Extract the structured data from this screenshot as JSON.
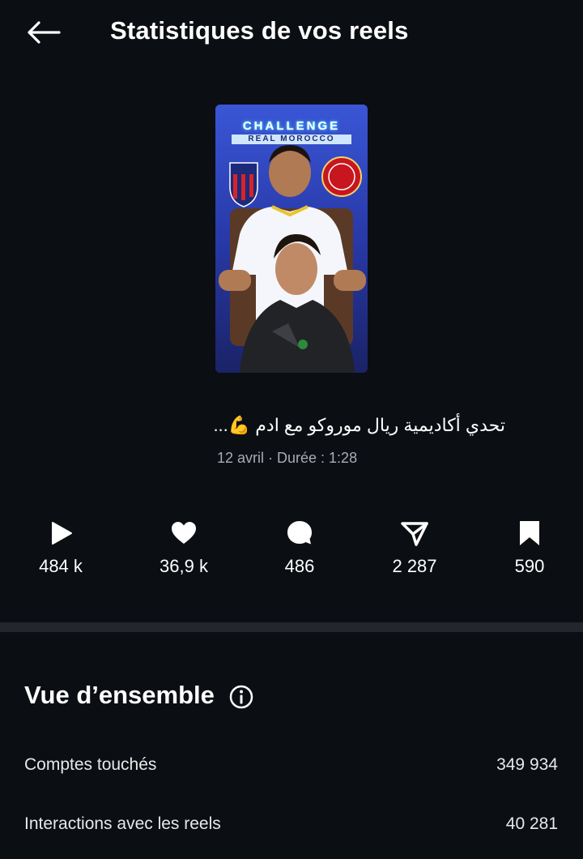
{
  "header": {
    "title": "Statistiques de vos reels",
    "back_icon": "arrow-left-icon"
  },
  "reel": {
    "thumbnail_text_line1": "CHALLENGE",
    "thumbnail_text_line2": "REAL MOROCCO",
    "caption": "تحدي أكاديمية ريال موروكو مع ادم 💪...",
    "meta": "12 avril · Durée : 1:28"
  },
  "stats": [
    {
      "icon": "play-icon",
      "value": "484 k"
    },
    {
      "icon": "heart-icon",
      "value": "36,9 k"
    },
    {
      "icon": "comment-icon",
      "value": "486"
    },
    {
      "icon": "share-icon",
      "value": "2 287"
    },
    {
      "icon": "bookmark-icon",
      "value": "590"
    }
  ],
  "overview": {
    "title": "Vue d’ensemble",
    "info_icon": "info-icon",
    "rows": [
      {
        "label": "Comptes touchés",
        "value": "349 934"
      },
      {
        "label": "Interactions avec les reels",
        "value": "40 281"
      }
    ]
  },
  "colors": {
    "background": "#0b0e13",
    "divider": "#23262c",
    "text_primary": "#ffffff",
    "text_secondary": "#a8acb3"
  }
}
